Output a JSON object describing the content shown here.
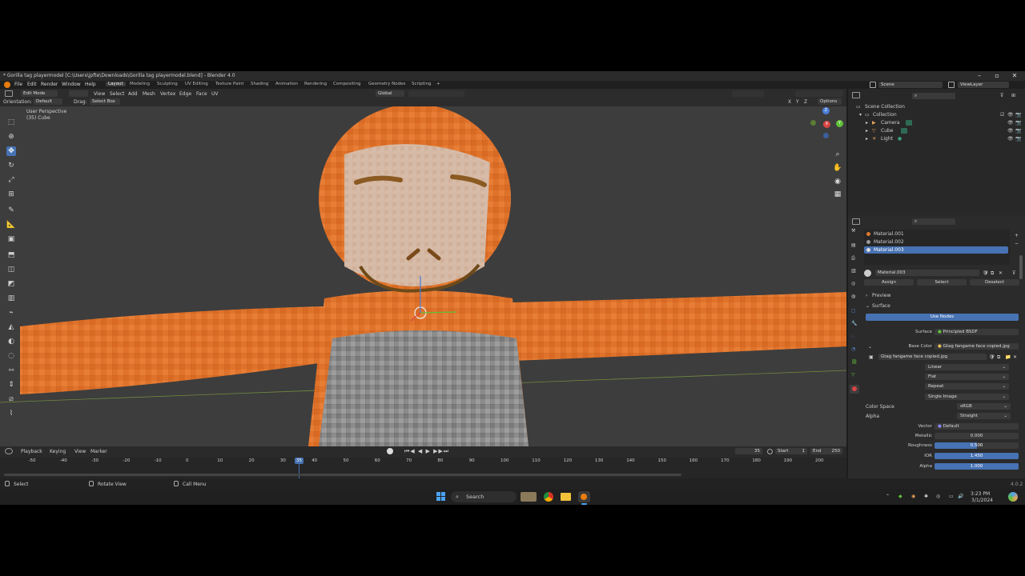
{
  "window": {
    "title": "* Gorilla tag playermodel [C:\\Users\\jpfte\\Downloads\\Gorilla tag playermodel.blend] - Blender 4.0"
  },
  "menu": [
    "File",
    "Edit",
    "Render",
    "Window",
    "Help"
  ],
  "workspaces": [
    "Layout",
    "Modeling",
    "Sculpting",
    "UV Editing",
    "Texture Paint",
    "Shading",
    "Animation",
    "Rendering",
    "Compositing",
    "Geometry Nodes",
    "Scripting"
  ],
  "workspace_add": "+",
  "scene": {
    "name": "Scene",
    "view_layer": "ViewLayer"
  },
  "viewport_header": {
    "mode": "Edit Mode",
    "menus": [
      "View",
      "Select",
      "Add",
      "Mesh",
      "Vertex",
      "Edge",
      "Face",
      "UV"
    ],
    "transform": "Global",
    "orientation_label": "Orientation:",
    "orientation_value": "Default",
    "drag_label": "Drag:",
    "drag_value": "Select Box",
    "options": "Options",
    "axes": [
      "X",
      "Y",
      "Z"
    ]
  },
  "viewport": {
    "perspective": "User Perspective",
    "object": "(35) Cube"
  },
  "gizmo": {
    "x": "X",
    "y": "Y",
    "z": "Z"
  },
  "timeline": {
    "menus": [
      "Playback",
      "Keying",
      "View",
      "Marker"
    ],
    "current_frame": "35",
    "start_label": "Start",
    "start": "1",
    "end_label": "End",
    "end": "250",
    "ticks": [
      "-50",
      "-40",
      "-30",
      "-20",
      "-10",
      "0",
      "10",
      "20",
      "30",
      "35",
      "40",
      "50",
      "60",
      "70",
      "80",
      "90",
      "100",
      "110",
      "120",
      "130",
      "140",
      "150",
      "160",
      "170",
      "180",
      "190",
      "200"
    ],
    "current_tick": "35"
  },
  "status": {
    "select": "Select",
    "rotate": "Rotate View",
    "menu": "Call Menu",
    "version": "4.0.2"
  },
  "outliner": {
    "root": "Scene Collection",
    "collection": "Collection",
    "items": [
      "Camera",
      "Cube",
      "Light"
    ]
  },
  "properties": {
    "materials": [
      "Material.001",
      "Material.002",
      "Material.003"
    ],
    "active_material": "Material.003",
    "assign": "Assign",
    "select": "Select",
    "deselect": "Deselect",
    "preview": "Preview",
    "surface_panel": "Surface",
    "use_nodes": "Use Nodes",
    "surface_label": "Surface",
    "surface_value": "Principled BSDF",
    "base_color_label": "Base Color",
    "base_color_value": "Gtag fangame face copied.jpg",
    "image_name": "Gtag fangame face copied.jpg",
    "interpolation": "Linear",
    "projection": "Flat",
    "extension": "Repeat",
    "source": "Single Image",
    "color_space_label": "Color Space",
    "color_space_value": "sRGB",
    "alpha_label": "Alpha",
    "alpha_value": "Straight",
    "vector_label": "Vector",
    "vector_value": "Default",
    "metallic_label": "Metallic",
    "metallic_value": "0.000",
    "roughness_label": "Roughness",
    "roughness_value": "0.500",
    "ior_label": "IOR",
    "ior_value": "1.450",
    "alpha2_label": "Alpha",
    "alpha2_value": "1.000"
  },
  "taskbar": {
    "search": "Search",
    "time": "3:23 PM",
    "date": "3/1/2024"
  },
  "colors": {
    "accent": "#4772b3",
    "fur": "#e0732b",
    "face": "#d4b8a5",
    "chest": "#8a8a8a",
    "viewport_bg": "#3d3d3d"
  }
}
